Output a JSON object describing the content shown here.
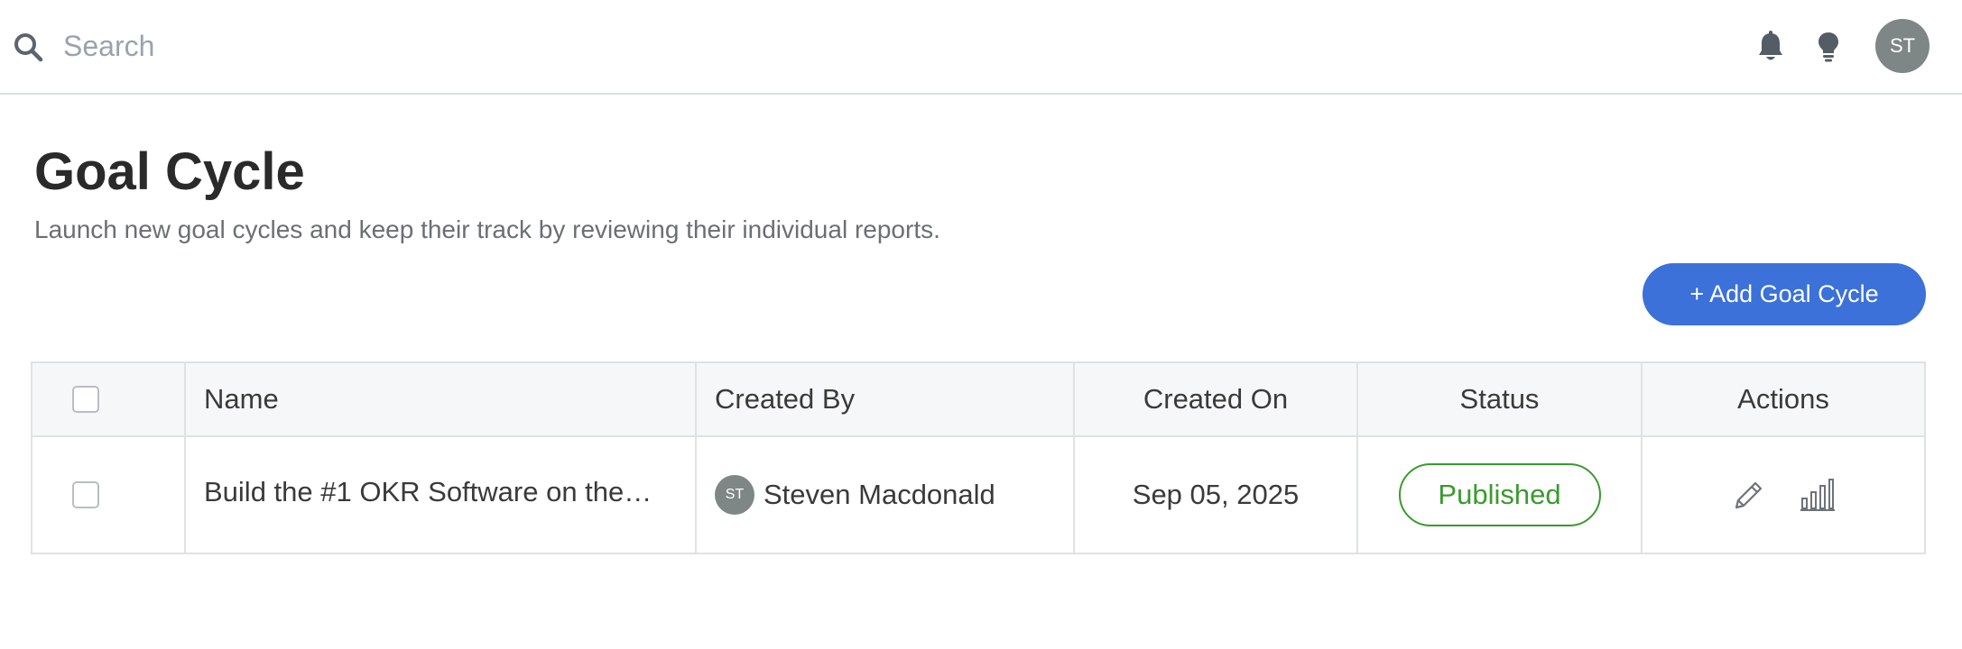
{
  "topbar": {
    "search_placeholder": "Search",
    "avatar_initials": "ST"
  },
  "page": {
    "title": "Goal Cycle",
    "subtitle": "Launch new goal cycles and keep their track by reviewing their individual reports.",
    "add_button_label": "+ Add Goal Cycle"
  },
  "table": {
    "columns": [
      "Name",
      "Created By",
      "Created On",
      "Status",
      "Actions"
    ],
    "rows": [
      {
        "name": "Build the #1 OKR Software on the…",
        "created_by_initials": "ST",
        "created_by": "Steven Macdonald",
        "created_on": "Sep 05, 2025",
        "status": "Published"
      }
    ]
  },
  "colors": {
    "accent": "#3b71d8",
    "status_published": "#3a9a2e",
    "avatar_bg": "#7e8785"
  },
  "icons": [
    "search-icon",
    "bell-icon",
    "lightbulb-icon",
    "edit-pencil-icon",
    "bar-chart-icon"
  ]
}
